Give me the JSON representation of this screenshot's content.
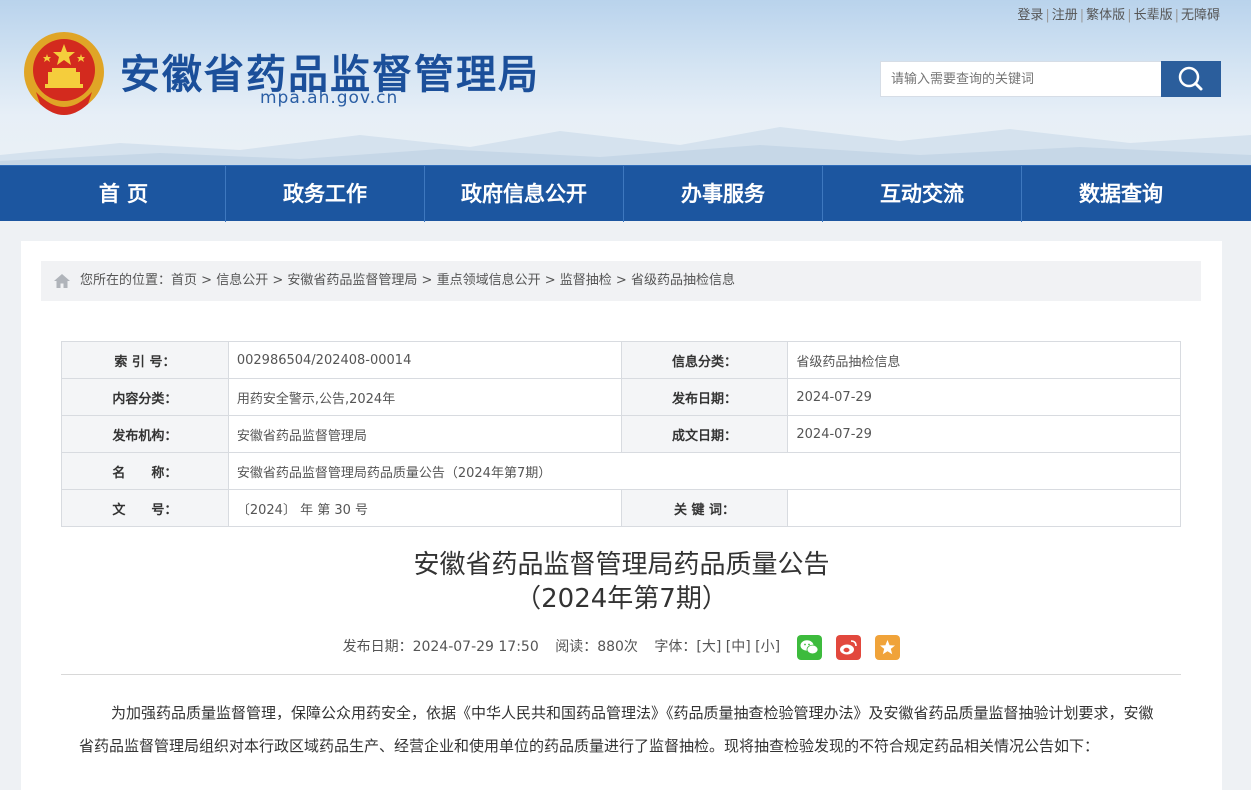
{
  "header": {
    "top_links": [
      "登录",
      "注册",
      "繁体版",
      "长辈版",
      "无障碍"
    ],
    "site_title": "安徽省药品监督管理局",
    "site_domain": "mpa.ah.gov.cn",
    "search_placeholder": "请输入需要查询的关键词",
    "emblem_icon": "national-emblem-icon"
  },
  "nav": [
    "首 页",
    "政务工作",
    "政府信息公开",
    "办事服务",
    "互动交流",
    "数据查询"
  ],
  "breadcrumb": {
    "prefix": "您所在的位置：",
    "items": [
      "首页",
      "信息公开",
      "安徽省药品监督管理局",
      "重点领域信息公开",
      "监督抽检",
      "省级药品抽检信息"
    ],
    "separator": " > "
  },
  "meta": {
    "index_no_label": "索 引 号：",
    "index_no": "002986504/202408-00014",
    "info_category_label": "信息分类：",
    "info_category": "省级药品抽检信息",
    "content_category_label": "内容分类：",
    "content_category": "用药安全警示,公告,2024年",
    "publish_date_label": "发布日期：",
    "publish_date": "2024-07-29",
    "publisher_label": "发布机构：",
    "publisher": "安徽省药品监督管理局",
    "created_date_label": "成文日期：",
    "created_date": "2024-07-29",
    "name_label": "名　　称：",
    "name": "安徽省药品监督管理局药品质量公告（2024年第7期）",
    "doc_no_label": "文　　号：",
    "doc_no": "〔2024〕 年 第 30 号",
    "keywords_label": "关 键 词：",
    "keywords": ""
  },
  "article": {
    "title_line1": "安徽省药品监督管理局药品质量公告",
    "title_line2": "（2024年第7期）",
    "publish_info": "发布日期：2024-07-29 17:50",
    "reads": "阅读：880次",
    "font_size": "字体：[大] [中] [小]",
    "body": "为加强药品质量监督管理，保障公众用药安全，依据《中华人民共和国药品管理法》《药品质量抽查检验管理办法》及安徽省药品质量监督抽验计划要求，安徽省药品监督管理局组织对本行政区域药品生产、经营企业和使用单位的药品质量进行了监督抽检。现将抽查检验发现的不符合规定药品相关情况公告如下："
  },
  "colors": {
    "nav_bg": "#1c56a0",
    "title_blue": "#1b4f9a",
    "wechat": "#3dbb3d",
    "weibo": "#e2483d",
    "favorite": "#f0a33a"
  }
}
